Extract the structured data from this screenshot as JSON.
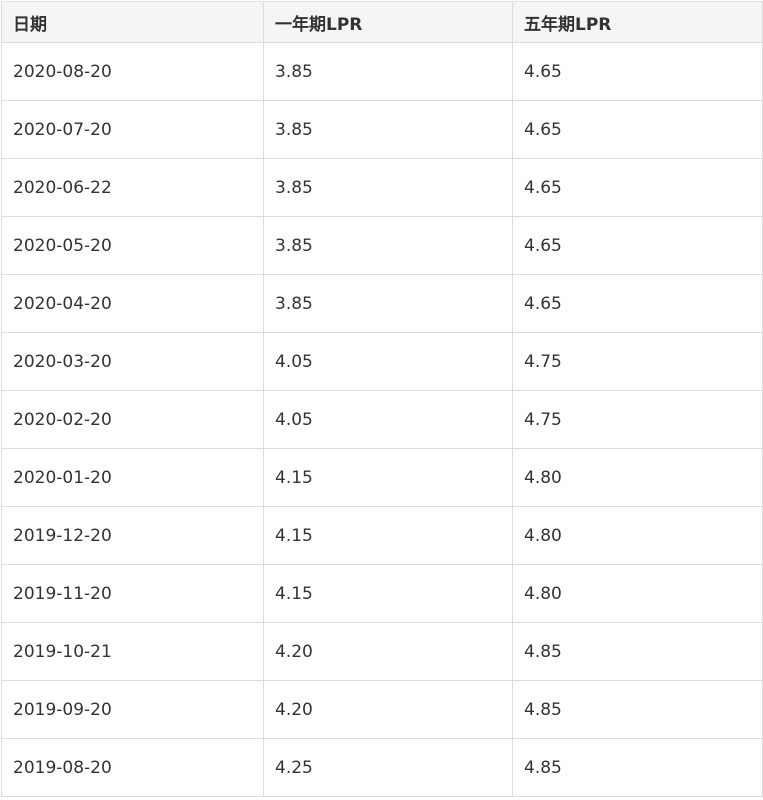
{
  "table": {
    "headers": [
      "日期",
      "一年期LPR",
      "五年期LPR"
    ],
    "rows": [
      [
        "2020-08-20",
        "3.85",
        "4.65"
      ],
      [
        "2020-07-20",
        "3.85",
        "4.65"
      ],
      [
        "2020-06-22",
        "3.85",
        "4.65"
      ],
      [
        "2020-05-20",
        "3.85",
        "4.65"
      ],
      [
        "2020-04-20",
        "3.85",
        "4.65"
      ],
      [
        "2020-03-20",
        "4.05",
        "4.75"
      ],
      [
        "2020-02-20",
        "4.05",
        "4.75"
      ],
      [
        "2020-01-20",
        "4.15",
        "4.80"
      ],
      [
        "2019-12-20",
        "4.15",
        "4.80"
      ],
      [
        "2019-11-20",
        "4.15",
        "4.80"
      ],
      [
        "2019-10-21",
        "4.20",
        "4.85"
      ],
      [
        "2019-09-20",
        "4.20",
        "4.85"
      ],
      [
        "2019-08-20",
        "4.25",
        "4.85"
      ]
    ]
  }
}
